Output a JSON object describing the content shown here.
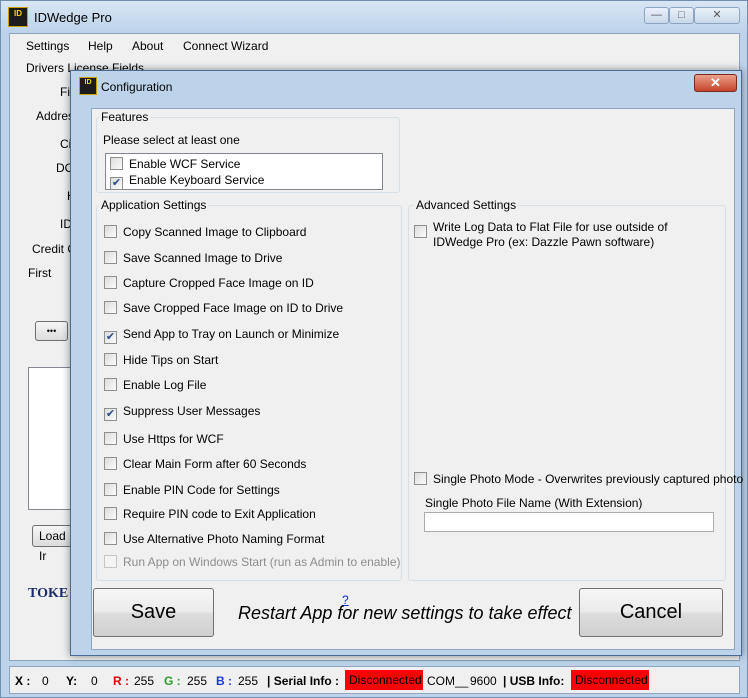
{
  "app": {
    "title": "IDWedge Pro",
    "logo_text": "ID"
  },
  "window_buttons": {
    "minimize": "—",
    "maximize": "□",
    "close": "✕"
  },
  "menu": [
    "Settings",
    "Help",
    "About",
    "Connect Wizard"
  ],
  "background": {
    "group_label": "Drivers License Fields",
    "field_labels": [
      "Fir",
      "Address",
      "Cit",
      "DO",
      "H",
      "IDr"
    ],
    "credit_label": "Credit Ca",
    "first_label": "First",
    "ellipsis_button": "•••",
    "load_button": "Load Ir",
    "token_logo": "TOKE"
  },
  "status_bar": {
    "x_label": "X :",
    "x_value": "0",
    "y_label": "Y:",
    "y_value": "0",
    "r_label": "R :",
    "r_value": "255",
    "g_label": "G :",
    "g_value": "255",
    "b_label": "B :",
    "b_value": "255",
    "serial_label": "| Serial Info :",
    "serial_status": "Disconnected",
    "com_value": "COM__",
    "baud_value": "9600",
    "usb_label": "| USB Info:",
    "usb_status": "Disconnected"
  },
  "dialog": {
    "title": "Configuration",
    "close_glyph": "✕",
    "features": {
      "legend": "Features",
      "hint": "Please select at least one",
      "items": [
        {
          "label": "Enable WCF Service",
          "checked": false
        },
        {
          "label": "Enable Keyboard Service",
          "checked": true
        }
      ]
    },
    "application_settings": {
      "legend": "Application Settings",
      "items": [
        {
          "label": "Copy Scanned Image to Clipboard",
          "checked": false
        },
        {
          "label": "Save Scanned Image to Drive",
          "checked": false
        },
        {
          "label": "Capture Cropped Face Image on ID",
          "checked": false
        },
        {
          "label": "Save Cropped Face Image on ID to Drive",
          "checked": false
        },
        {
          "label": "Send App to Tray on Launch or Minimize",
          "checked": true
        },
        {
          "label": "Hide Tips on Start",
          "checked": false
        },
        {
          "label": "Enable Log File",
          "checked": false
        },
        {
          "label": "Suppress User Messages",
          "checked": true
        },
        {
          "label": "Use Https for WCF",
          "checked": false
        },
        {
          "label": "Clear Main Form after 60 Seconds",
          "checked": false
        },
        {
          "label": "Enable PIN Code for Settings",
          "checked": false
        },
        {
          "label": "Require PIN code to Exit Application",
          "checked": false
        },
        {
          "label": "Use Alternative Photo Naming Format",
          "checked": false
        },
        {
          "label": "Run App on Windows Start (run as Admin to enable)",
          "checked": false,
          "disabled": true
        }
      ],
      "help_link": "?"
    },
    "advanced_settings": {
      "legend": "Advanced Settings",
      "write_log_line1": "Write Log Data to Flat File for use outside of",
      "write_log_line2": "IDWedge Pro (ex: Dazzle Pawn software)",
      "write_log_checked": false,
      "single_photo_label": "Single Photo Mode - Overwrites previously captured photo",
      "single_photo_checked": false,
      "photo_file_label": "Single Photo File Name (With Extension)",
      "photo_file_value": ""
    },
    "save_button": "Save",
    "restart_message": "Restart App for new settings to take effect",
    "cancel_button": "Cancel"
  }
}
